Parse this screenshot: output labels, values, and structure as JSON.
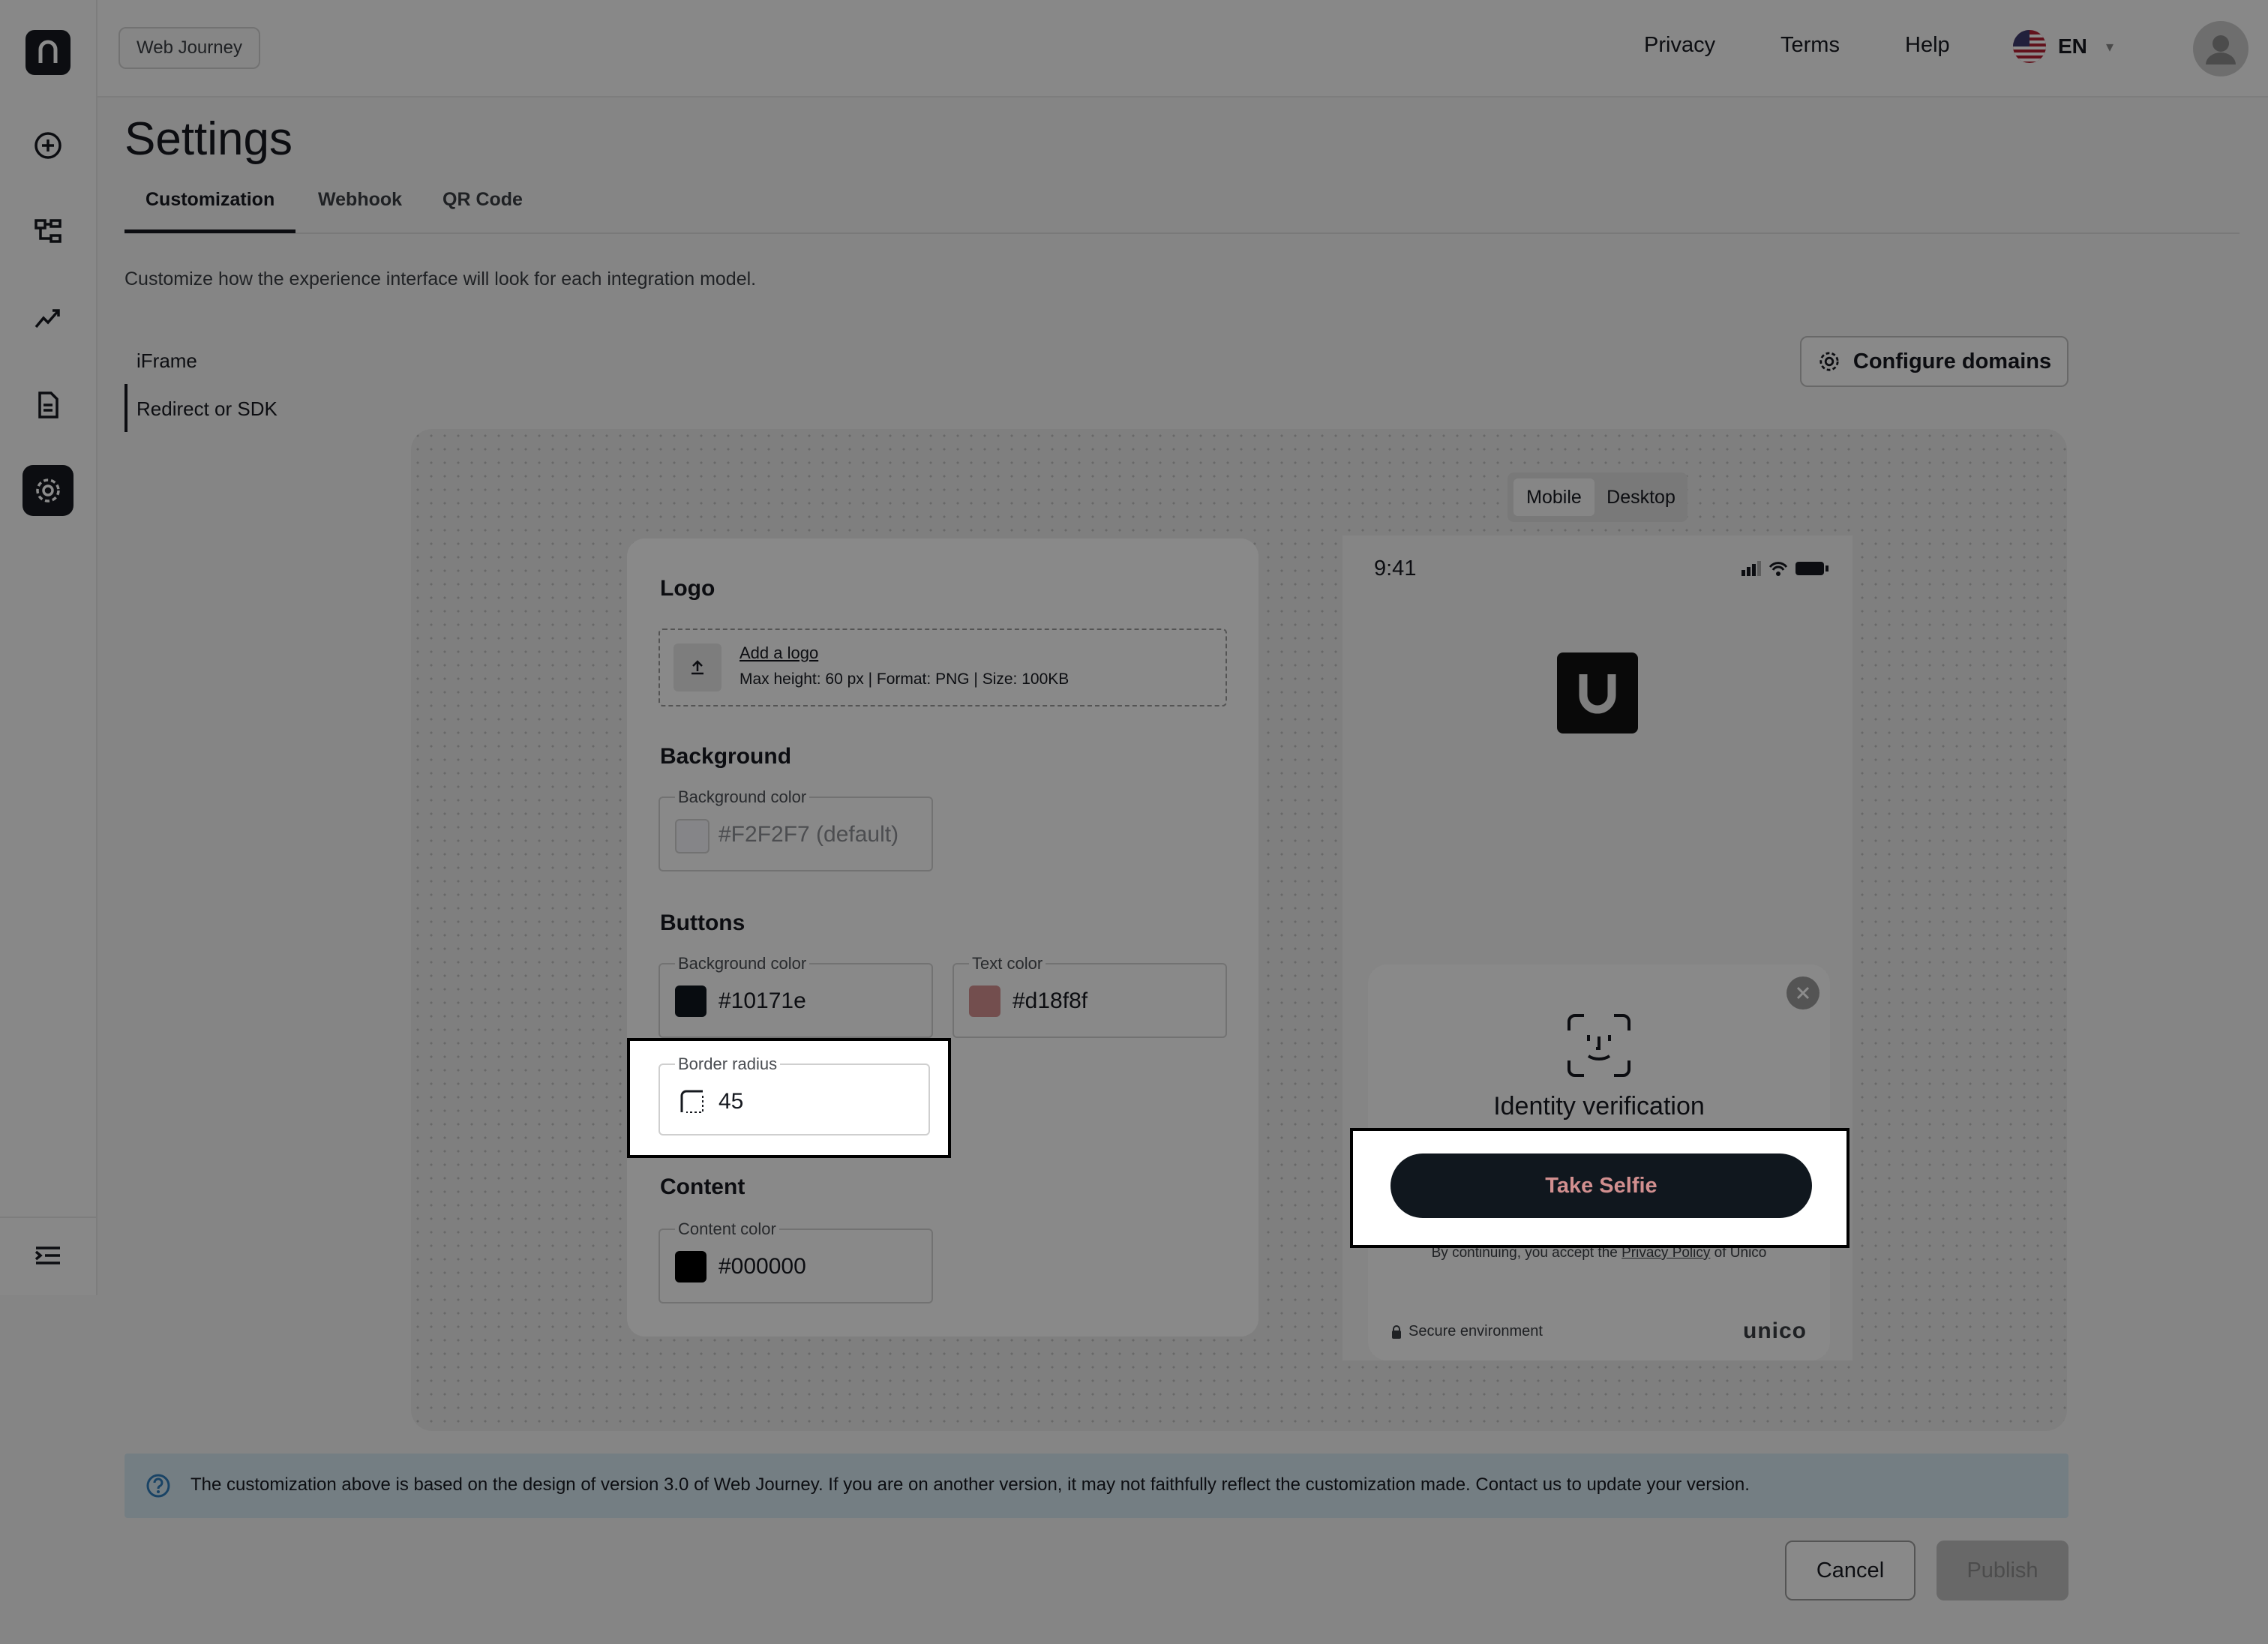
{
  "topbar": {
    "journey_chip": "Web Journey",
    "links": [
      "Privacy",
      "Terms",
      "Help"
    ],
    "language": "EN"
  },
  "page": {
    "title": "Settings",
    "tabs": [
      "Customization",
      "Webhook",
      "QR Code"
    ],
    "description": "Customize how the experience interface will look for each integration model.",
    "models": [
      "iFrame",
      "Redirect or SDK"
    ],
    "configure_domains": "Configure domains"
  },
  "preview_toggle": [
    "Mobile",
    "Desktop"
  ],
  "form": {
    "logo_title": "Logo",
    "add_logo": "Add a logo",
    "logo_hint": "Max height: 60 px | Format: PNG | Size: 100KB",
    "background_title": "Background",
    "background_color_label": "Background color",
    "background_color_value": "#F2F2F7 (default)",
    "buttons_title": "Buttons",
    "button_bg_label": "Background color",
    "button_bg_value": "#10171e",
    "button_text_label": "Text color",
    "button_text_value": "#d18f8f",
    "border_radius_label": "Border radius",
    "border_radius_value": "45",
    "content_title": "Content",
    "content_color_label": "Content color",
    "content_color_value": "#000000"
  },
  "phone": {
    "time": "9:41",
    "modal_title": "Identity verification",
    "cta": "Take Selfie",
    "consent_prefix": "By continuing, you accept the ",
    "consent_link": "Privacy Policy",
    "consent_suffix": " of Unico",
    "secure": "Secure environment",
    "brand": "unico"
  },
  "info_banner": "The customization above is based on the design of version 3.0 of Web Journey. If you are on another version, it may not faithfully reflect the customization made. Contact us to update your version.",
  "footer": {
    "cancel": "Cancel",
    "publish": "Publish"
  },
  "colors": {
    "button_bg": "#10171e",
    "button_text": "#d18f8f",
    "content": "#000000",
    "background_default": "#F2F2F7"
  }
}
